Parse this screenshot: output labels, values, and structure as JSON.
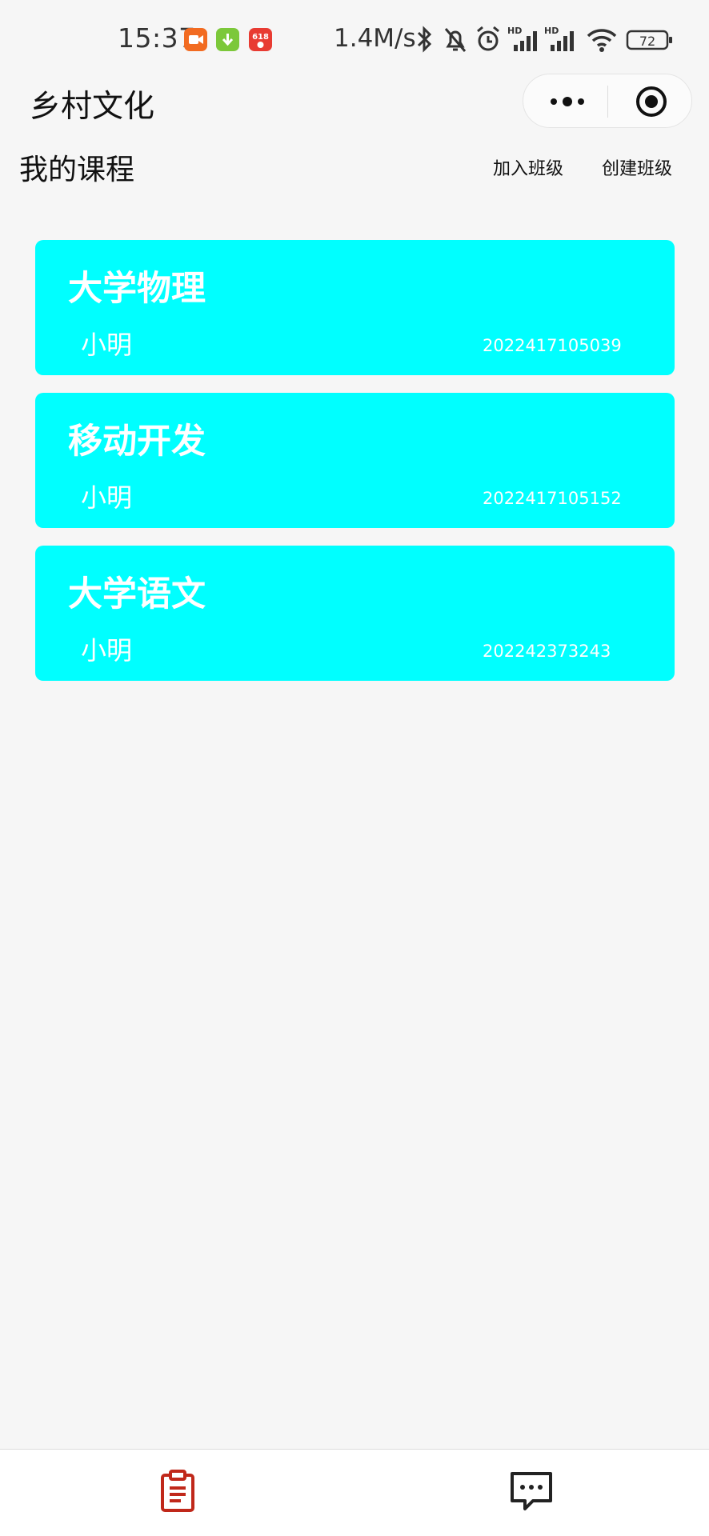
{
  "status_bar": {
    "time": "15:37",
    "network_speed": "1.4M/s",
    "battery": "72",
    "icons": [
      "video-app-icon",
      "download-app-icon",
      "618-app-icon",
      "bluetooth-icon",
      "mute-icon",
      "alarm-icon",
      "signal-hd-icon",
      "signal-hd-icon",
      "wifi-icon",
      "battery-icon"
    ]
  },
  "header": {
    "title": "乡村文化",
    "capsule": {
      "more_icon": "more-dots-icon",
      "close_icon": "target-circle-icon"
    }
  },
  "section": {
    "title": "我的课程",
    "join_label": "加入班级",
    "create_label": "创建班级"
  },
  "courses": [
    {
      "name": "大学物理",
      "teacher": "小明",
      "code": "2022417105039"
    },
    {
      "name": "移动开发",
      "teacher": "小明",
      "code": "2022417105152"
    },
    {
      "name": "大学语文",
      "teacher": "小明",
      "code": "202242373243"
    }
  ],
  "tab_bar": {
    "tabs": [
      {
        "icon": "clipboard-icon",
        "active": true
      },
      {
        "icon": "chat-bubble-icon",
        "active": false
      }
    ]
  },
  "colors": {
    "card_background": "#00ffff",
    "page_background": "#f6f6f6",
    "active_tab": "#c0281a",
    "inactive_tab": "#222222"
  }
}
